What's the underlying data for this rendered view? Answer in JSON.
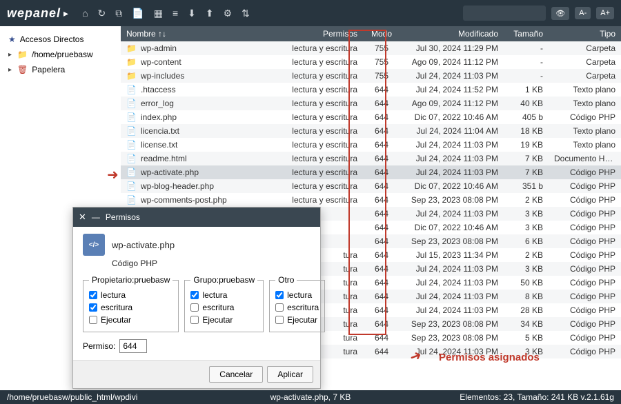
{
  "logo": "wepanel",
  "toolbar_icons": [
    "home",
    "reload",
    "new-window",
    "file",
    "grid",
    "list",
    "download",
    "upload",
    "settings",
    "filter"
  ],
  "header_buttons": {
    "eye": "👁",
    "a_minus": "A-",
    "a_plus": "A+"
  },
  "sidebar": {
    "items": [
      {
        "icon": "star",
        "label": "Accesos Directos"
      },
      {
        "icon": "folder",
        "label": "/home/pruebasw"
      },
      {
        "icon": "trash",
        "label": "Papelera"
      }
    ]
  },
  "columns": {
    "name": "Nombre",
    "perm": "Permisos",
    "mode": "Modo",
    "mod": "Modificado",
    "size": "Tamaño",
    "type": "Tipo"
  },
  "files": [
    {
      "icon": "folder",
      "name": "wp-admin",
      "perm": "lectura y escritura",
      "mode": "755",
      "mod": "Jul 30, 2024 11:29 PM",
      "size": "-",
      "type": "Carpeta"
    },
    {
      "icon": "folder",
      "name": "wp-content",
      "perm": "lectura y escritura",
      "mode": "755",
      "mod": "Ago 09, 2024 11:12 PM",
      "size": "-",
      "type": "Carpeta"
    },
    {
      "icon": "folder",
      "name": "wp-includes",
      "perm": "lectura y escritura",
      "mode": "755",
      "mod": "Jul 24, 2024 11:03 PM",
      "size": "-",
      "type": "Carpeta"
    },
    {
      "icon": "file",
      "name": ".htaccess",
      "perm": "lectura y escritura",
      "mode": "644",
      "mod": "Jul 24, 2024 11:52 PM",
      "size": "1 KB",
      "type": "Texto plano"
    },
    {
      "icon": "file",
      "name": "error_log",
      "perm": "lectura y escritura",
      "mode": "644",
      "mod": "Ago 09, 2024 11:12 PM",
      "size": "40 KB",
      "type": "Texto plano"
    },
    {
      "icon": "php",
      "name": "index.php",
      "perm": "lectura y escritura",
      "mode": "644",
      "mod": "Dic 07, 2022 10:46 AM",
      "size": "405 b",
      "type": "Código PHP"
    },
    {
      "icon": "file",
      "name": "licencia.txt",
      "perm": "lectura y escritura",
      "mode": "644",
      "mod": "Jul 24, 2024 11:04 AM",
      "size": "18 KB",
      "type": "Texto plano"
    },
    {
      "icon": "file",
      "name": "license.txt",
      "perm": "lectura y escritura",
      "mode": "644",
      "mod": "Jul 24, 2024 11:03 PM",
      "size": "19 KB",
      "type": "Texto plano"
    },
    {
      "icon": "file",
      "name": "readme.html",
      "perm": "lectura y escritura",
      "mode": "644",
      "mod": "Jul 24, 2024 11:03 PM",
      "size": "7 KB",
      "type": "Documento HTML"
    },
    {
      "icon": "php",
      "name": "wp-activate.php",
      "perm": "lectura y escritura",
      "mode": "644",
      "mod": "Jul 24, 2024 11:03 PM",
      "size": "7 KB",
      "type": "Código PHP",
      "selected": true
    },
    {
      "icon": "php",
      "name": "wp-blog-header.php",
      "perm": "lectura y escritura",
      "mode": "644",
      "mod": "Dic 07, 2022 10:46 AM",
      "size": "351 b",
      "type": "Código PHP"
    },
    {
      "icon": "php",
      "name": "wp-comments-post.php",
      "perm": "lectura y escritura",
      "mode": "644",
      "mod": "Sep 23, 2023 08:08 PM",
      "size": "2 KB",
      "type": "Código PHP"
    },
    {
      "icon": "php",
      "name": "",
      "perm": "",
      "mode": "644",
      "mod": "Jul 24, 2024 11:03 PM",
      "size": "3 KB",
      "type": "Código PHP"
    },
    {
      "icon": "php",
      "name": "",
      "perm": "",
      "mode": "644",
      "mod": "Dic 07, 2022 10:46 AM",
      "size": "3 KB",
      "type": "Código PHP"
    },
    {
      "icon": "php",
      "name": "",
      "perm": "",
      "mode": "644",
      "mod": "Sep 23, 2023 08:08 PM",
      "size": "6 KB",
      "type": "Código PHP"
    },
    {
      "icon": "php",
      "name": "",
      "perm": "tura",
      "mode": "644",
      "mod": "Jul 15, 2023 11:34 PM",
      "size": "2 KB",
      "type": "Código PHP"
    },
    {
      "icon": "php",
      "name": "",
      "perm": "tura",
      "mode": "644",
      "mod": "Jul 24, 2024 11:03 PM",
      "size": "3 KB",
      "type": "Código PHP"
    },
    {
      "icon": "php",
      "name": "",
      "perm": "tura",
      "mode": "644",
      "mod": "Jul 24, 2024 11:03 PM",
      "size": "50 KB",
      "type": "Código PHP"
    },
    {
      "icon": "php",
      "name": "",
      "perm": "tura",
      "mode": "644",
      "mod": "Jul 24, 2024 11:03 PM",
      "size": "8 KB",
      "type": "Código PHP"
    },
    {
      "icon": "php",
      "name": "",
      "perm": "tura",
      "mode": "644",
      "mod": "Jul 24, 2024 11:03 PM",
      "size": "28 KB",
      "type": "Código PHP"
    },
    {
      "icon": "php",
      "name": "",
      "perm": "tura",
      "mode": "644",
      "mod": "Sep 23, 2023 08:08 PM",
      "size": "34 KB",
      "type": "Código PHP"
    },
    {
      "icon": "php",
      "name": "",
      "perm": "tura",
      "mode": "644",
      "mod": "Sep 23, 2023 08:08 PM",
      "size": "5 KB",
      "type": "Código PHP"
    },
    {
      "icon": "php",
      "name": "",
      "perm": "tura",
      "mode": "644",
      "mod": "Jul 24, 2024 11:03 PM",
      "size": "3 KB",
      "type": "Código PHP"
    }
  ],
  "dialog": {
    "title": "Permisos",
    "filename": "wp-activate.php",
    "filetype": "Código PHP",
    "groups": [
      {
        "legend": "Propietario:pruebasw",
        "read": true,
        "write": true,
        "exec": false
      },
      {
        "legend": "Grupo:pruebasw",
        "read": true,
        "write": false,
        "exec": false
      },
      {
        "legend": "Otro",
        "read": true,
        "write": false,
        "exec": false
      }
    ],
    "labels": {
      "read": "lectura",
      "write": "escritura",
      "exec": "Ejecutar",
      "perm": "Permiso:"
    },
    "perm_value": "644",
    "buttons": {
      "cancel": "Cancelar",
      "apply": "Aplicar"
    }
  },
  "annotation": "Permisos asignados",
  "footer": {
    "path": "/home/pruebasw/public_html/wpdivi",
    "mid": "wp-activate.php, 7 KB",
    "right": "Elementos: 23, Tamaño: 241 KB v.2.1.61g"
  }
}
